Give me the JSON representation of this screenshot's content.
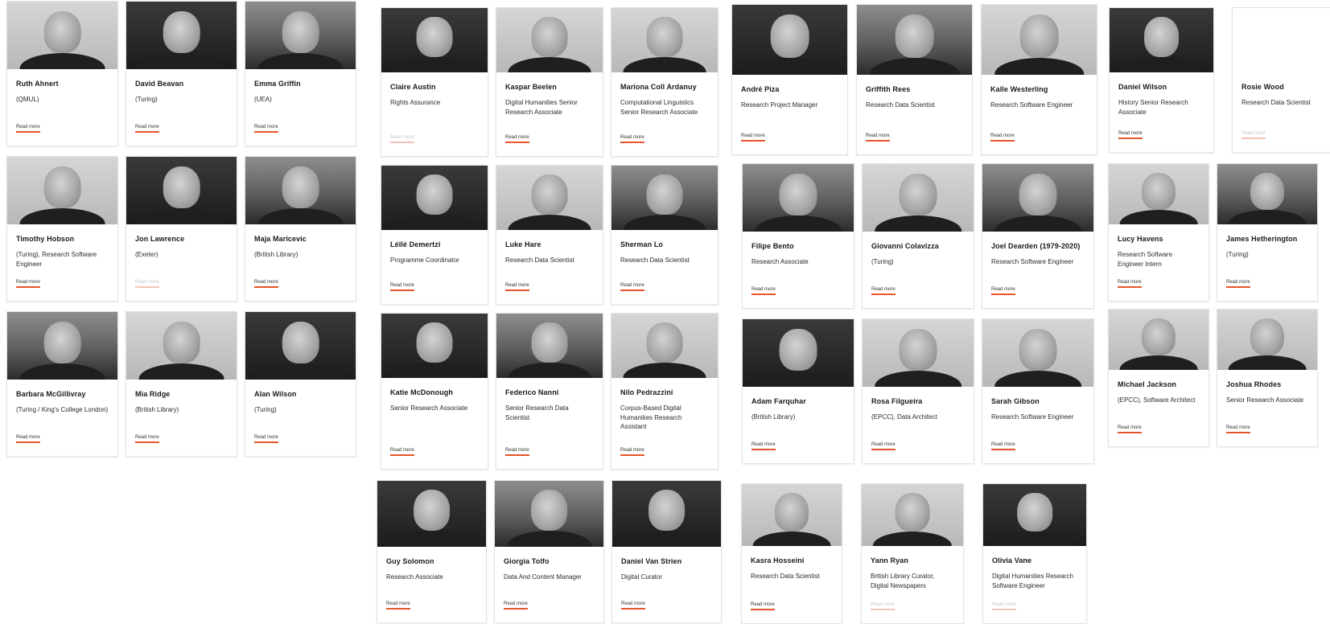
{
  "accent_color": "#e8542c",
  "groups": [
    {
      "people": [
        {
          "name": "Ruth Ahnert",
          "role": "(QMUL)",
          "link": "Read more",
          "photo": "light"
        },
        {
          "name": "David Beavan",
          "role": "(Turing)",
          "link": "Read more",
          "photo": "dark"
        },
        {
          "name": "Emma Griffin",
          "role": "(UEA)",
          "link": "Read more",
          "photo": "mid"
        },
        {
          "name": "Timothy Hobson",
          "role": "(Turing), Research Software Engineer",
          "link": "Read more",
          "photo": "light"
        },
        {
          "name": "Jon Lawrence",
          "role": "(Exeter)",
          "link": "Read more",
          "photo": "dark",
          "faded": true
        },
        {
          "name": "Maja Maricevic",
          "role": "(British Library)",
          "link": "Read more",
          "photo": "mid"
        },
        {
          "name": "Barbara McGillivray",
          "role": "(Turing / King's College London)",
          "link": "Read more",
          "photo": "mid"
        },
        {
          "name": "Mia Ridge",
          "role": "(British Library)",
          "link": "Read more",
          "photo": "light"
        },
        {
          "name": "Alan Wilson",
          "role": "(Turing)",
          "link": "Read more",
          "photo": "dark"
        }
      ]
    },
    {
      "people": [
        {
          "name": "Claire Austin",
          "role": "Rights Assurance",
          "link": "Read more",
          "photo": "dark",
          "faded": true
        },
        {
          "name": "Kaspar Beelen",
          "role": "Digital Humanities Senior Research Associate",
          "link": "Read more",
          "photo": "light"
        },
        {
          "name": "Mariona Coll Ardanuy",
          "role": "Computational Linguistics Senior Research Associate",
          "link": "Read more",
          "photo": "light"
        },
        {
          "name": "Léllé Demertzi",
          "role": "Programme Coordinator",
          "link": "Read more",
          "photo": "dark"
        },
        {
          "name": "Luke Hare",
          "role": "Research Data Scientist",
          "link": "Read more",
          "photo": "light"
        },
        {
          "name": "Sherman Lo",
          "role": "Research Data Scientist",
          "link": "Read more",
          "photo": "mid"
        },
        {
          "name": "Katie McDonough",
          "role": "Senior Research Associate",
          "link": "Read more",
          "photo": "dark"
        },
        {
          "name": "Federico Nanni",
          "role": "Senior Research Data Scientist",
          "link": "Read more",
          "photo": "mid"
        },
        {
          "name": "Nilo Pedrazzini",
          "role": "Corpus-Based Digital Humanities Research Assistant",
          "link": "Read more",
          "photo": "light"
        }
      ]
    },
    {
      "people": [
        {
          "name": "Guy Solomon",
          "role": "Research Associate",
          "link": "Read more",
          "photo": "dark"
        },
        {
          "name": "Giorgia Tolfo",
          "role": "Data And Content Manager",
          "link": "Read more",
          "photo": "mid"
        },
        {
          "name": "Daniel Van Strien",
          "role": "Digital Curator",
          "link": "Read more",
          "photo": "dark"
        }
      ]
    },
    {
      "people": [
        {
          "name": "André Piza",
          "role": "Research Project Manager",
          "link": "Read more",
          "photo": "dark"
        },
        {
          "name": "Griffith Rees",
          "role": "Research Data Scientist",
          "link": "Read more",
          "photo": "mid"
        },
        {
          "name": "Kalle Westerling",
          "role": "Research Software Engineer",
          "link": "Read more",
          "photo": "light"
        }
      ]
    },
    {
      "people": [
        {
          "name": "Daniel Wilson",
          "role": "History Senior Research Associate",
          "link": "Read more",
          "photo": "dark"
        },
        {
          "name": "Rosie Wood",
          "role": "Research Data Scientist",
          "link": "Read more",
          "photo": "blank",
          "faded": true
        }
      ]
    },
    {
      "people": [
        {
          "name": "Filipe Bento",
          "role": "Research Associate",
          "link": "Read more",
          "photo": "mid"
        },
        {
          "name": "Giovanni Colavizza",
          "role": "(Turing)",
          "link": "Read more",
          "photo": "light"
        },
        {
          "name": "Joel Dearden (1979-2020)",
          "role": "Research Software Engineer",
          "link": "Read more",
          "photo": "mid"
        },
        {
          "name": "Adam Farquhar",
          "role": "(British Library)",
          "link": "Read more",
          "photo": "dark"
        },
        {
          "name": "Rosa Filgueira",
          "role": "(EPCC), Data Architect",
          "link": "Read more",
          "photo": "light"
        },
        {
          "name": "Sarah Gibson",
          "role": "Research Software Engineer",
          "link": "Read more",
          "photo": "light"
        }
      ]
    },
    {
      "people": [
        {
          "name": "Lucy Havens",
          "role": "Research Software Engineer Intern",
          "link": "Read more",
          "photo": "light"
        },
        {
          "name": "James Hetherington",
          "role": "(Turing)",
          "link": "Read more",
          "photo": "mid"
        },
        {
          "name": "Michael Jackson",
          "role": "(EPCC), Software Architect",
          "link": "Read more",
          "photo": "light"
        },
        {
          "name": "Joshua Rhodes",
          "role": "Senior Research Associate",
          "link": "Read more",
          "photo": "light"
        }
      ]
    },
    {
      "people": [
        {
          "name": "Kasra Hosseini",
          "role": "Research Data Scientist",
          "link": "Read more",
          "photo": "light"
        },
        {
          "name": "Yann Ryan",
          "role": "British Library Curator, Digital Newspapers",
          "link": "Read more",
          "photo": "light",
          "faded": true
        },
        {
          "name": "Olivia Vane",
          "role": "Digital Humanities Research Software Engineer",
          "link": "Read more",
          "photo": "dark",
          "faded": true
        }
      ]
    }
  ]
}
